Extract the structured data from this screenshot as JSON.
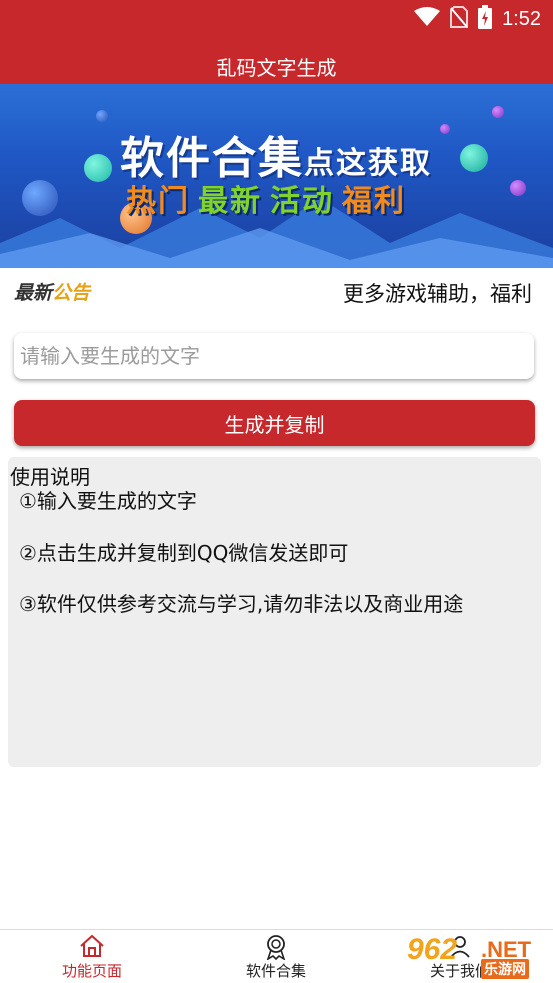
{
  "status_bar": {
    "time": "1:52",
    "icons": [
      "wifi-icon",
      "no-sim-icon",
      "battery-icon"
    ]
  },
  "header": {
    "title": "乱码文字生成"
  },
  "banner": {
    "line1_main": "软件合集",
    "line1_tail": "点这获取",
    "line2": [
      {
        "text": "热门",
        "color": "#f28b1e"
      },
      {
        "text": "最新",
        "color": "#7fd32a"
      },
      {
        "text": "活动",
        "color": "#7fd32a"
      },
      {
        "text": "福利",
        "color": "#f28b1e"
      }
    ]
  },
  "notice": {
    "logo_part1": "最新",
    "logo_part2": "公告",
    "text": "更多游戏辅助，福利"
  },
  "form": {
    "placeholder": "请输入要生成的文字",
    "button_label": "生成并复制"
  },
  "usage": {
    "title": "使用说明",
    "items": [
      "①输入要生成的文字",
      "②点击生成并复制到QQ微信发送即可",
      "③软件仅供参考交流与学习,请勿非法以及商业用途"
    ]
  },
  "bottom_nav": {
    "tabs": [
      {
        "label": "功能页面",
        "icon": "home-icon",
        "active": true
      },
      {
        "label": "软件合集",
        "icon": "award-icon",
        "active": false
      },
      {
        "label": "关于我们",
        "icon": "user-icon",
        "active": false
      }
    ]
  },
  "watermark": {
    "number": "962",
    "suffix": ".NET",
    "site": "乐游网"
  },
  "colors": {
    "accent": "#c6282c",
    "panel": "#eeeeee",
    "banner_blue": "#2b6fd6"
  }
}
